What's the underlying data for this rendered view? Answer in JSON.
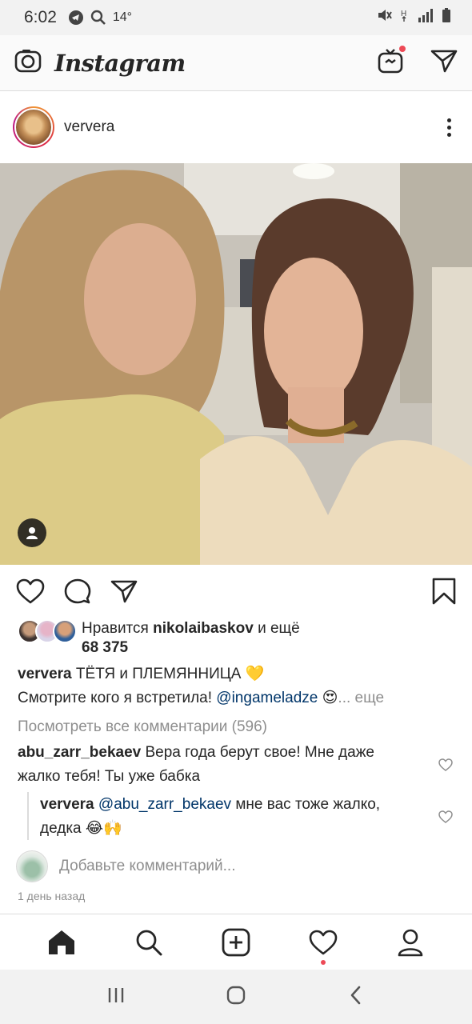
{
  "status_bar": {
    "time": "6:02",
    "temperature": "14°"
  },
  "header": {
    "app_title": "Instagram"
  },
  "post": {
    "username": "ververa",
    "likes": {
      "prefix": "Нравится",
      "user": "nikolaibaskov",
      "suffix": "и ещё",
      "count": "68 375"
    },
    "caption": {
      "user": "ververa",
      "text": "ТЁТЯ и ПЛЕМЯННИЦА",
      "emoji1": "💛",
      "line2": "Смотрите кого я встретила!",
      "mention": "@ingameladze",
      "emoji2": "😍",
      "more": "... еще"
    },
    "view_all_comments": "Посмотреть все комментарии (596)",
    "comments": [
      {
        "user": "abu_zarr_bekaev",
        "text1": "Вера года берут свое! Мне даже",
        "text2": "жалко тебя! Ты уже бабка"
      },
      {
        "user": "ververa",
        "mention": "@abu_zarr_bekaev",
        "text1": "мне вас тоже жалко,",
        "text2": "дедка",
        "emoji": "😂🙌"
      }
    ],
    "add_comment_placeholder": "Добавьте комментарий...",
    "time_ago": "1 день назад"
  },
  "icons": {
    "camera": "camera-icon",
    "igtv": "igtv-icon",
    "direct": "direct-icon",
    "more": "more-icon",
    "like": "heart-icon",
    "comment": "comment-icon",
    "share": "share-icon",
    "save": "bookmark-icon",
    "home": "home-icon",
    "search": "search-icon",
    "new_post": "new-post-icon",
    "activity": "activity-icon",
    "profile": "profile-icon"
  },
  "colors": {
    "link": "#003569",
    "muted": "#8e8e8e",
    "notification": "#ed4956",
    "text": "#262626"
  }
}
